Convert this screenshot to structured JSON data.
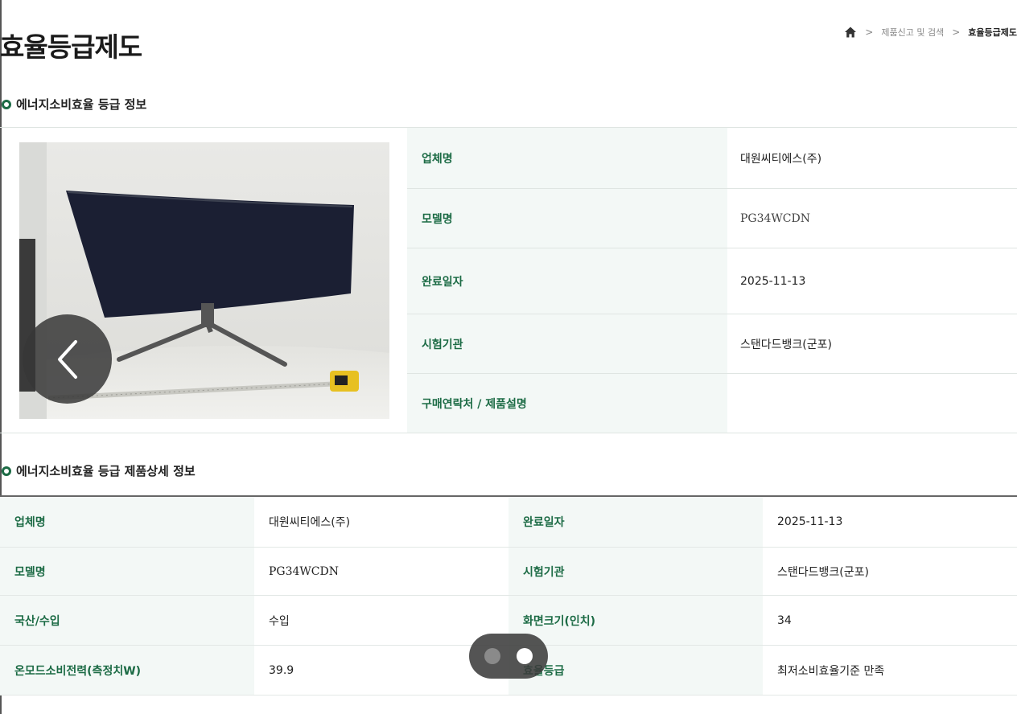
{
  "page": {
    "title": "효율등급제도"
  },
  "breadcrumb": {
    "items": [
      "제품신고 및 검색",
      "효율등급제도"
    ],
    "separator": ">"
  },
  "section1": {
    "title": "에너지소비효율 등급 정보",
    "rows": [
      {
        "label": "업체명",
        "value": "대원씨티에스(주)"
      },
      {
        "label": "모델명",
        "value": "PG34WCDN"
      },
      {
        "label": "완료일자",
        "value": "2025-11-13"
      },
      {
        "label": "시험기관",
        "value": "스탠다드뱅크(군포)"
      },
      {
        "label": "구매연락처 / 제품설명",
        "value": ""
      }
    ]
  },
  "section2": {
    "title": "에너지소비효율 등급 제품상세 정보",
    "rows": [
      [
        {
          "label": "업체명",
          "value": "대원씨티에스(주)"
        },
        {
          "label": "완료일자",
          "value": "2025-11-13"
        }
      ],
      [
        {
          "label": "모델명",
          "value": "PG34WCDN"
        },
        {
          "label": "시험기관",
          "value": "스탠다드뱅크(군포)"
        }
      ],
      [
        {
          "label": "국산/수입",
          "value": "수입"
        },
        {
          "label": "화면크기(인치)",
          "value": "34"
        }
      ],
      [
        {
          "label": "온모드소비전력(측정치W)",
          "value": "39.9"
        },
        {
          "label": "효율등급",
          "value": "최저소비효율기준 만족"
        }
      ]
    ]
  },
  "gallery": {
    "total_slides": 2,
    "active_slide": 2
  },
  "colors": {
    "accent_green": "#1c6b45",
    "label_bg": "#f3f8f6"
  },
  "icons": {
    "home": "home-icon",
    "prev": "chevron-left-icon",
    "section": "ring-bullet-icon"
  }
}
